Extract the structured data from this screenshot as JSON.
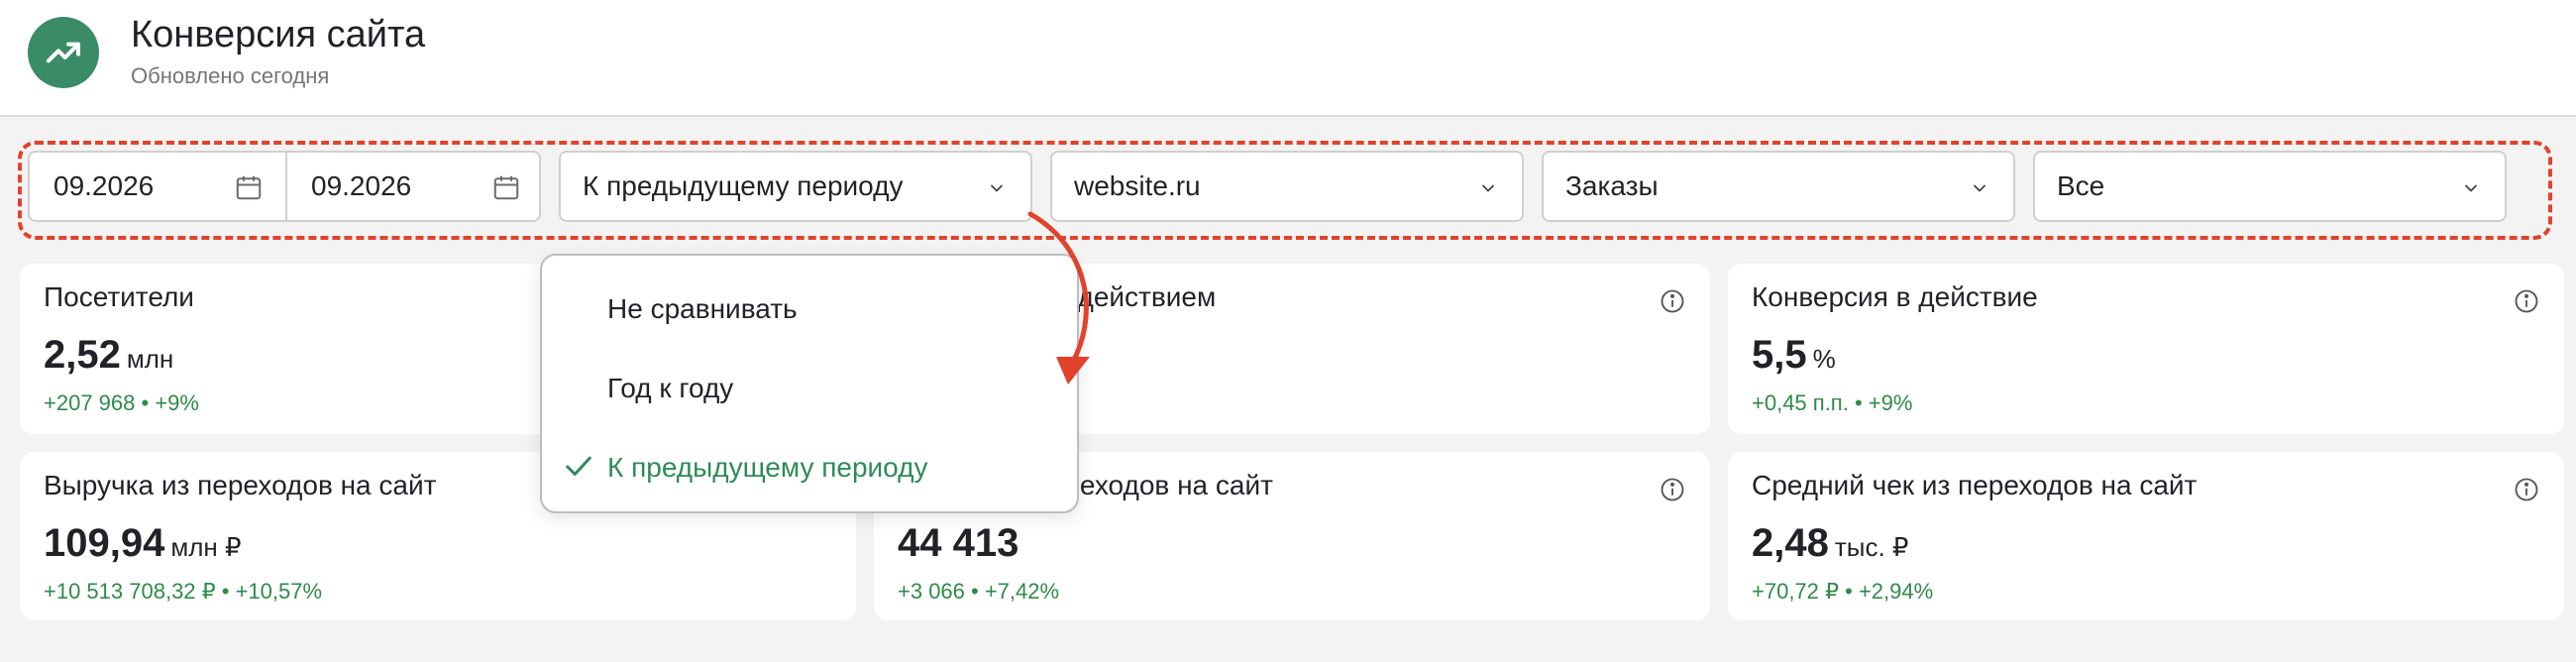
{
  "header": {
    "title": "Конверсия сайта",
    "subtitle": "Обновлено сегодня",
    "logo_icon": "trending-up-icon",
    "accent": "#3a8c67"
  },
  "filters": {
    "date_from": "09.2026",
    "date_to": "09.2026",
    "compare": "К предыдущему периоду",
    "site": "website.ru",
    "metric": "Заказы",
    "segment": "Все",
    "highlight_color": "#e2422c"
  },
  "dropdown": {
    "options": [
      "Не сравнивать",
      "Год к году",
      "К предыдущему периоду"
    ],
    "selected": "К предыдущему периоду",
    "selected_color": "#2e8b57"
  },
  "cards": [
    {
      "title": "Посетители",
      "value": "2,52",
      "unit": "млн",
      "delta": "+207 968 • +9%"
    },
    {
      "title": "Посетители с действием",
      "value": "",
      "unit": "",
      "delta": ""
    },
    {
      "title": "Конверсия в действие",
      "value": "5,5",
      "unit": "%",
      "delta": "+0,45 п.п. • +9%"
    },
    {
      "title": "Выручка из переходов на сайт",
      "value": "109,94",
      "unit": "млн ₽",
      "delta": "+10 513 708,32 ₽ • +10,57%"
    },
    {
      "title": "Заказы из переходов на сайт",
      "value": "44 413",
      "unit": "",
      "delta": "+3 066 • +7,42%"
    },
    {
      "title": "Средний чек из переходов на сайт",
      "value": "2,48",
      "unit": "тыс. ₽",
      "delta": "+70,72 ₽ • +2,94%"
    }
  ],
  "delta_color": "#2e8b47"
}
